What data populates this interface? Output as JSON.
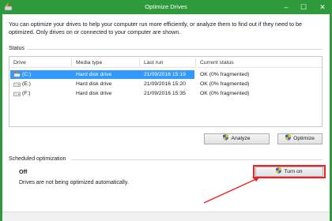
{
  "window": {
    "title": "Optimize Drives",
    "controls": [
      "minimize",
      "maximize",
      "close"
    ]
  },
  "intro_text": "You can optimize your drives to help your computer run more efficiently, or analyze them to find out if they need to be optimized. Only drives on or connected to your computer are shown.",
  "status": {
    "label": "Status",
    "columns": {
      "drive": "Drive",
      "media_type": "Media type",
      "last_run": "Last run",
      "current_status": "Current status"
    },
    "rows": [
      {
        "drive": "(C:)",
        "media_type": "Hard disk drive",
        "last_run": "21/09/2016 15:19",
        "current_status": "OK (0% fragmented)",
        "selected": true
      },
      {
        "drive": "(E:)",
        "media_type": "Hard disk drive",
        "last_run": "21/09/2016 15:20",
        "current_status": "OK (0% fragmented)",
        "selected": false
      },
      {
        "drive": "(F:)",
        "media_type": "Hard disk drive",
        "last_run": "21/09/2016 15:35",
        "current_status": "OK (0% fragmented)",
        "selected": false
      }
    ],
    "analyze_label": "Analyze",
    "optimize_label": "Optimize"
  },
  "scheduled": {
    "label": "Scheduled optimization",
    "state": "Off",
    "description": "Drives are not being optimized automatically.",
    "turn_on_label": "Turn on"
  },
  "colors": {
    "titlebar": "#2e9a3c",
    "selection": "#3399ff",
    "annotation": "#ee2222"
  }
}
